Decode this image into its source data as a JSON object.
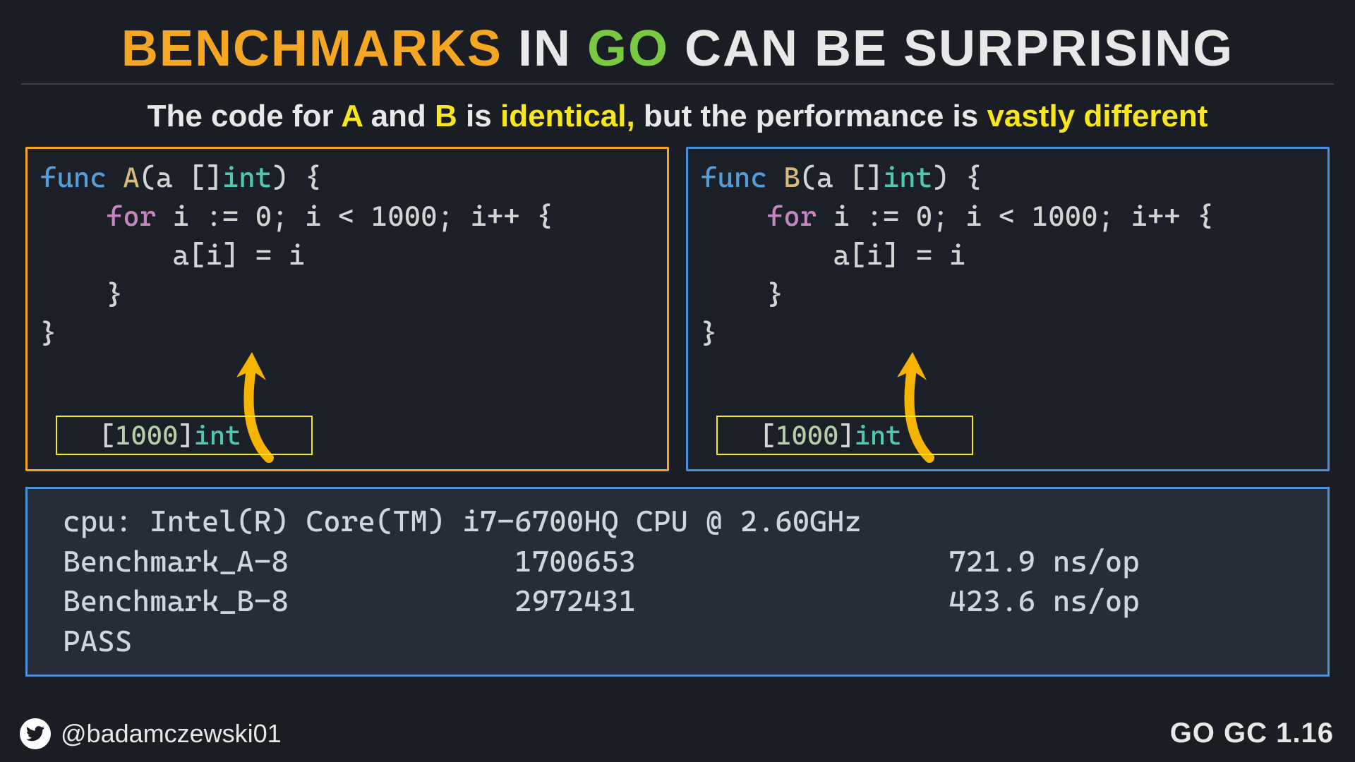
{
  "title": {
    "w1": "BENCHMARKS",
    "w2": "IN",
    "w3": "GO",
    "w4": "CAN BE SURPRISING"
  },
  "subtitle": {
    "p1": "The code for ",
    "a": "A",
    "p2": " and ",
    "b": "B",
    "p3": " is ",
    "ident": "identical,",
    "p4": " but the performance is ",
    "vast": "vastly different"
  },
  "codeA": {
    "fn": "func",
    "name": "A",
    "sig_open": "(a []",
    "type": "int",
    "sig_close": ") {",
    "for": "for",
    "loop": " i := 0; i < 1000; i++ {",
    "body": "        a[i] = i",
    "close1": "    }",
    "close2": "}"
  },
  "codeB": {
    "fn": "func",
    "name": "B",
    "sig_open": "(a []",
    "type": "int",
    "sig_close": ") {",
    "for": "for",
    "loop": " i := 0; i < 1000; i++ {",
    "body": "        a[i] = i",
    "close1": "    }",
    "close2": "}"
  },
  "tag": {
    "open": "[",
    "num": "1000",
    "close": "]",
    "type": "int"
  },
  "output": {
    "l1": "cpu: Intel(R) Core(TM) i7-6700HQ CPU @ 2.60GHz",
    "l2": "Benchmark_A-8             1700653                  721.9 ns/op",
    "l3": "Benchmark_B-8             2972431                  423.6 ns/op",
    "l4": "PASS"
  },
  "footer": {
    "handle": "@badamczewski01",
    "version": "GO GC 1.16"
  }
}
